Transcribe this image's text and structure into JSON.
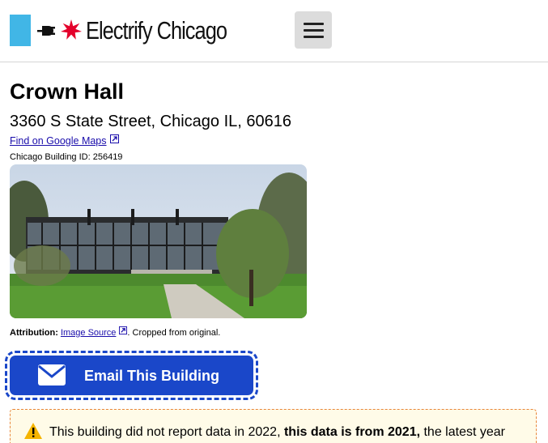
{
  "header": {
    "site_title": "Electrify Chicago",
    "logo_icons": [
      "plug-icon",
      "chicago-star-icon"
    ],
    "menu_icon": "hamburger-menu-icon"
  },
  "building": {
    "name": "Crown Hall",
    "address": "3360 S State Street, Chicago IL, 60616",
    "maps_link": "Find on Google Maps",
    "building_id_text": "Chicago Building ID: 256419"
  },
  "attribution": {
    "label": "Attribution:",
    "link": "Image Source",
    "suffix": ". Cropped from original."
  },
  "email_button": {
    "label": "Email This Building",
    "icon": "envelope-icon"
  },
  "notice": {
    "icon": "warning-icon",
    "text_before": "This building did not report data in 2022, ",
    "text_bold": "this data is from 2021,",
    "text_after": " the latest year"
  },
  "colors": {
    "logo_blue": "#41b6e6",
    "star_red": "#e4002b",
    "button_blue": "#1a47c9",
    "link_blue": "#1a0dab",
    "notice_border": "#e8863a"
  }
}
